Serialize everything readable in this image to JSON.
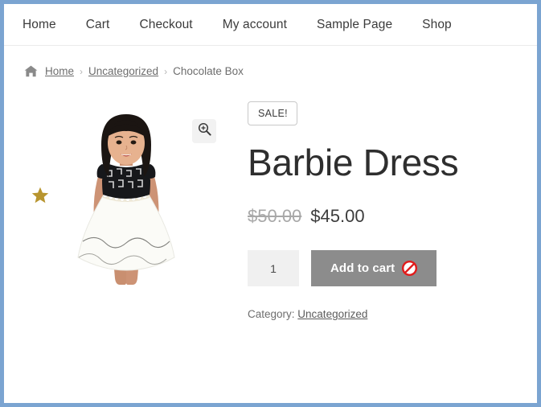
{
  "nav": {
    "items": [
      {
        "label": "Home"
      },
      {
        "label": "Cart"
      },
      {
        "label": "Checkout"
      },
      {
        "label": "My account"
      },
      {
        "label": "Sample Page"
      },
      {
        "label": "Shop"
      }
    ]
  },
  "breadcrumb": {
    "home_icon": "home-icon",
    "home": "Home",
    "separator1": "›",
    "category": "Uncategorized",
    "separator2": "›",
    "current": "Chocolate Box"
  },
  "gallery": {
    "zoom_icon": "magnifier-plus-icon",
    "star_decoration": "star-icon",
    "image_alt": "Barbie Dress"
  },
  "summary": {
    "sale_badge": "SALE!",
    "title": "Barbie Dress",
    "price_old": "$50.00",
    "price_new": "$45.00",
    "quantity": "1",
    "quantity_placeholder": "1",
    "add_to_cart": "Add to cart",
    "cart_state_icon": "not-allowed-icon",
    "meta_label": "Category:",
    "meta_value": "Uncategorized"
  },
  "colors": {
    "page_border": "#7ba4d1",
    "nav_text": "#3b3b3b",
    "title": "#2e2e2e",
    "price_old": "#a8a8a8",
    "price_new": "#3d3d3d",
    "button_bg": "#8c8c8c",
    "qty_bg": "#f0f0f0",
    "star": "#b8952f",
    "not_allowed": "#e01b1b"
  }
}
